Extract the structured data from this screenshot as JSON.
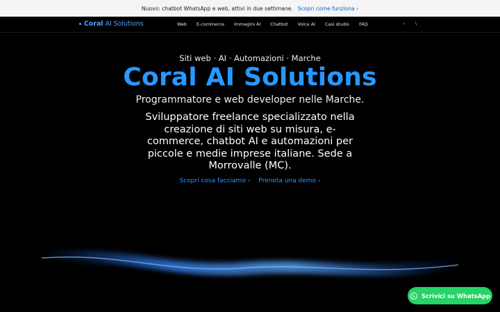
{
  "announcement": {
    "text": "Nuovo: chatbot WhatsApp e web, attivi in due settimane.",
    "link": "Scopri come funziona ›"
  },
  "nav": {
    "brand_bold": "Coral",
    "brand_rest": "AI Solutions",
    "links": [
      "Web",
      "E-commerce",
      "Immagini AI",
      "Chatbot",
      "Voice AI",
      "Casi studio",
      "FAQ"
    ],
    "extra1": "‹",
    "extra2": "\\"
  },
  "hero": {
    "eyebrow": "Siti web · AI · Automazioni · Marche",
    "title": "Coral AI Solutions",
    "subtitle": "Programmatore e web developer nelle Marche.",
    "description": "Sviluppatore freelance specializzato nella creazione di siti web su misura, e-commerce, chatbot AI e automazioni per piccole e medie imprese italiane. Sede a Morrovalle (MC).",
    "cta_primary": "Scopri cosa facciamo ›",
    "cta_secondary": "Prenota una demo ›"
  },
  "whatsapp": {
    "label": "Scrivici su WhatsApp",
    "icon": "whatsapp-icon"
  },
  "colors": {
    "accent": "#2997ff",
    "whatsapp": "#25d366",
    "background": "#000000"
  }
}
